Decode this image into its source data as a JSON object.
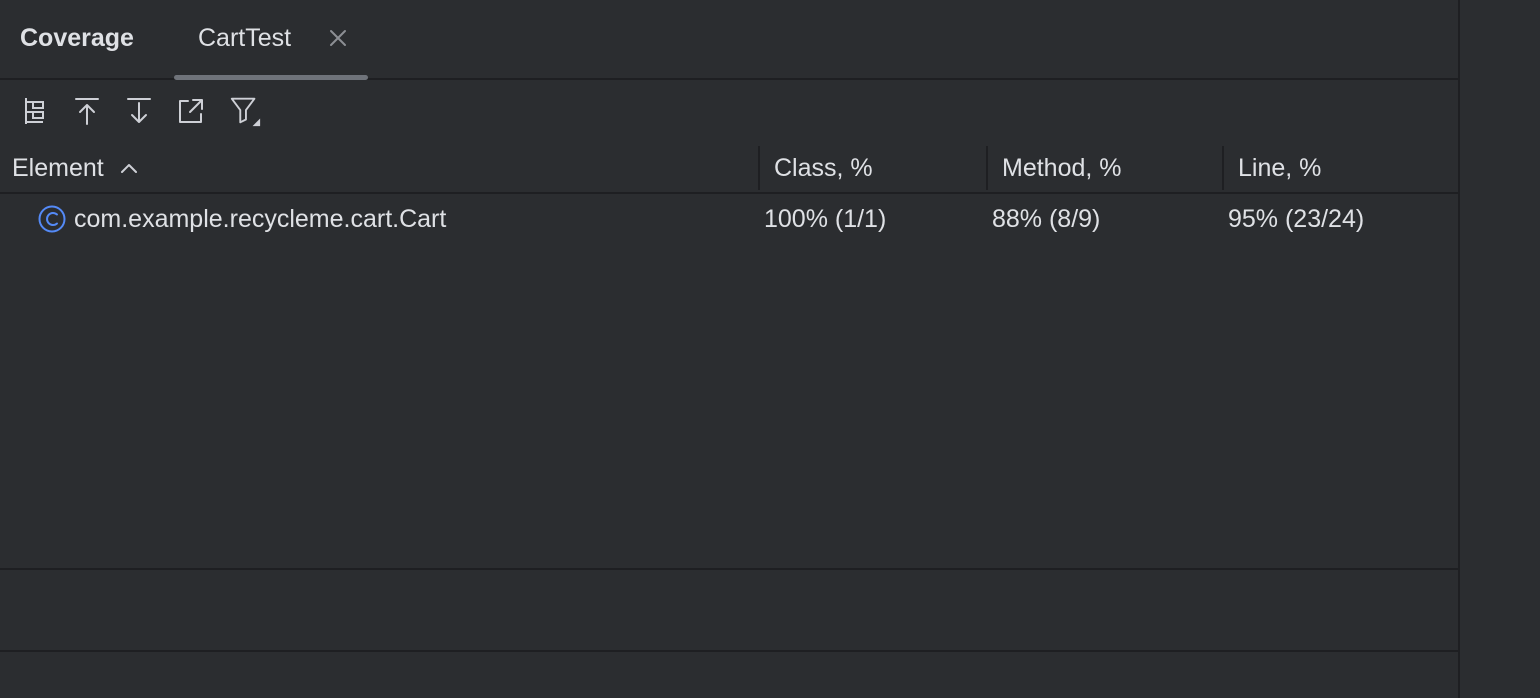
{
  "panel": {
    "title": "Coverage"
  },
  "tabs": [
    {
      "label": "CartTest",
      "active": true,
      "close_icon": "close-icon"
    }
  ],
  "toolbar": {
    "buttons": [
      {
        "name": "flatten-packages-icon"
      },
      {
        "name": "navigate-up-icon"
      },
      {
        "name": "navigate-down-icon"
      },
      {
        "name": "export-icon"
      },
      {
        "name": "filter-icon"
      }
    ]
  },
  "table": {
    "columns": [
      {
        "label": "Element",
        "sorted": "ascending"
      },
      {
        "label": "Class, %"
      },
      {
        "label": "Method, %"
      },
      {
        "label": "Line, %"
      }
    ],
    "rows": [
      {
        "icon": "class-icon",
        "element": "com.example.recycleme.cart.Cart",
        "class_pct": "100% (1/1)",
        "method_pct": "88% (8/9)",
        "line_pct": "95% (23/24)"
      }
    ]
  },
  "colors": {
    "background": "#2b2d30",
    "divider": "#1e1f22",
    "text": "#dfe1e5",
    "icon": "#ced0d6",
    "class_icon_accent": "#548af7",
    "tab_underline": "#6f737a"
  }
}
